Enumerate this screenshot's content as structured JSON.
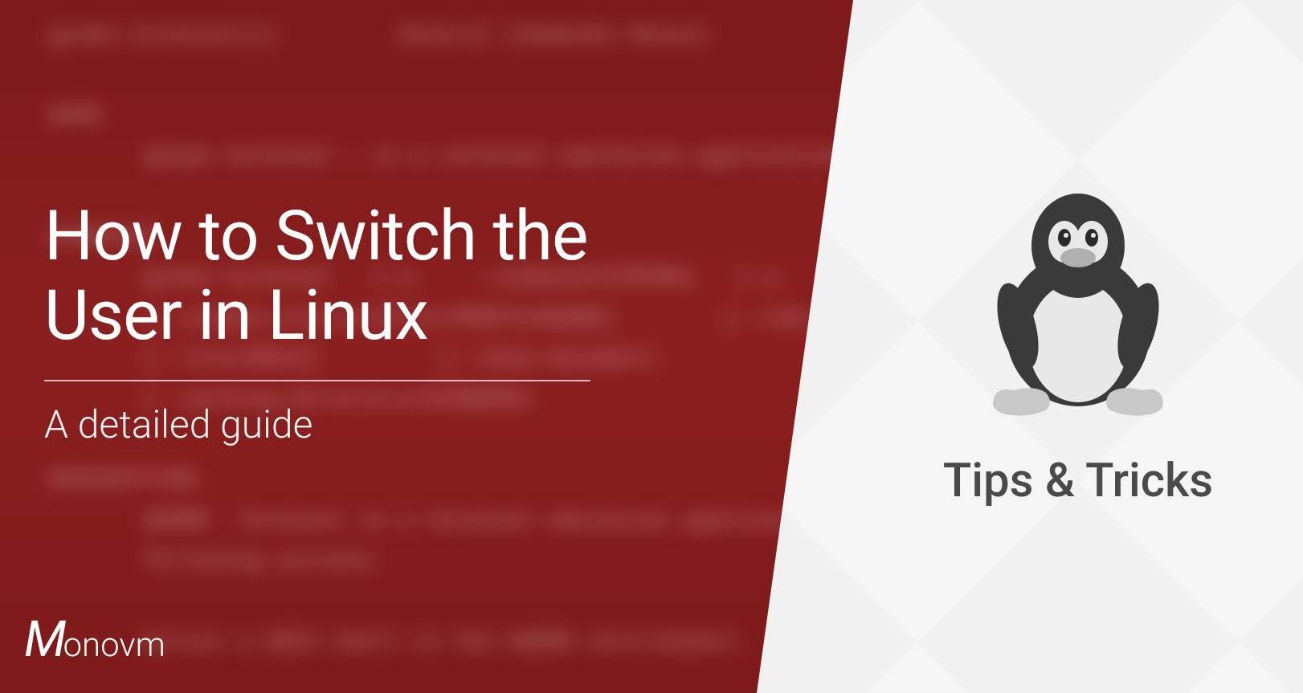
{
  "title": {
    "line1": "How to Switch the",
    "line2": "User in Linux"
  },
  "subtitle": "A detailed guide",
  "right_panel": {
    "text": "Tips & Tricks",
    "icon": "tux-linux-penguin"
  },
  "logo": {
    "letter": "M",
    "text": "onovm"
  },
  "background_hint": "blurred terminal man page for gnome-terminal",
  "colors": {
    "left_bg": "#8b1f1f",
    "right_bg": "#f5f5f5",
    "text_white": "#ffffff",
    "text_gray": "#4a4a4a"
  }
}
